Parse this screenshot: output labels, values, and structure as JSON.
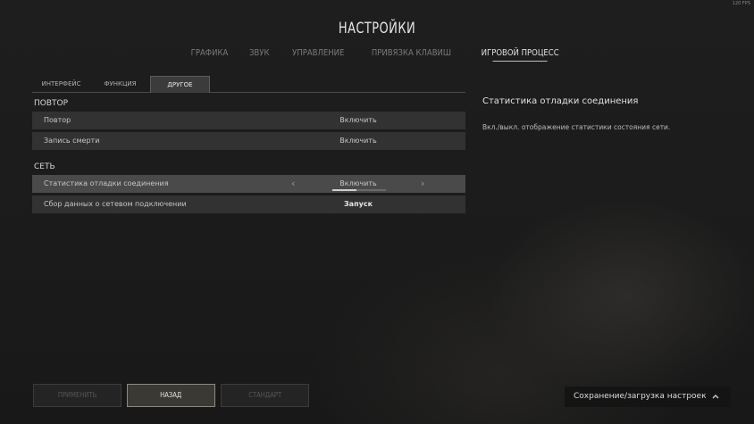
{
  "fps": "120 FPS",
  "title": "НАСТРОЙКИ",
  "main_tabs": [
    "ГРАФИКА",
    "ЗВУК",
    "УПРАВЛЕНИЕ",
    "ПРИВЯЗКА КЛАВИШ",
    "ИГРОВОЙ ПРОЦЕСС"
  ],
  "sub_tabs": [
    "ИНТЕРФЕЙС",
    "ФУНКЦИЯ",
    "ДРУГОЕ"
  ],
  "sections": {
    "replay": {
      "title": "ПОВТОР",
      "rows": [
        {
          "label": "Повтор",
          "value": "Включить"
        },
        {
          "label": "Запись смерти",
          "value": "Включить"
        }
      ]
    },
    "network": {
      "title": "СЕТЬ",
      "rows": [
        {
          "label": "Статистика отладки соединения",
          "value": "Включить",
          "level": 0.45
        },
        {
          "label": "Сбор данных о сетевом подключении",
          "value": "Запуск"
        }
      ]
    }
  },
  "description": {
    "title": "Статистика отладки соединения",
    "text": "Вкл./выкл. отображение статистики состояния сети."
  },
  "buttons": {
    "apply": "ПРИМЕНИТЬ",
    "back": "НАЗАД",
    "default": "СТАНДАРТ"
  },
  "save_load": "Сохранение/загрузка настроек",
  "icons": {
    "left_arrow": "chevron-left-icon",
    "right_arrow": "chevron-right-icon",
    "expand": "chevron-up-icon"
  }
}
